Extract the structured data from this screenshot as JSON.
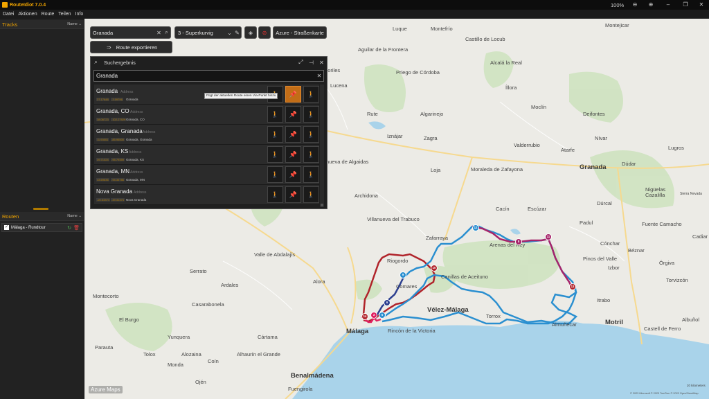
{
  "app": {
    "title": "RouteIdiot 7.0.4",
    "zoom": "100%"
  },
  "menu": [
    "Datei",
    "Aktionen",
    "Route",
    "Teilen",
    "Info"
  ],
  "tracks_panel": {
    "title": "Tracks",
    "sort": "Name ⌄"
  },
  "routes_panel": {
    "title": "Routen",
    "sort": "Name ⌄",
    "items": [
      {
        "name": "Málaga - Rundtour",
        "checked": true
      }
    ]
  },
  "toolbar": {
    "search_value": "Granada",
    "style_select": "3 - Superkurvig",
    "map_style": "Azure - Straßenkarte",
    "export_label": "Route exportieren"
  },
  "search_panel": {
    "title": "Suchergebnis",
    "query": "Granada",
    "tooltip": "Fügt der aktuellen Route einen Via-Punkt hinzu",
    "results": [
      {
        "name": "Granada",
        "type": "Address",
        "lat": "37.17648",
        "lon": "-3.59796",
        "sub": "Granada"
      },
      {
        "name": "Granada, CO",
        "type": "Address",
        "lat": "38.06723",
        "lon": "-102.27929",
        "sub": "Granada, CO"
      },
      {
        "name": "Granada, Granada",
        "type": "Address",
        "lat": "11.93001",
        "lon": "-85.95500",
        "sub": "Granada, Granada"
      },
      {
        "name": "Granada, KS",
        "type": "Address",
        "lat": "39.71024",
        "lon": "-95.79359",
        "sub": "Granada, KS"
      },
      {
        "name": "Granada, MN",
        "type": "Address",
        "lat": "43.69636",
        "lon": "-94.34786",
        "sub": "Granada, MN"
      },
      {
        "name": "Nova Granada",
        "type": "Address",
        "lat": "-20.53374",
        "lon": "-49.31374",
        "sub": "Nova Granada"
      }
    ]
  },
  "map": {
    "provider_logo": "Azure Maps",
    "copyright": "© 2023 Microsoft  © 2023 TomTom  © 2023 OpenStreetMap",
    "scale": "20 kilometers",
    "places": [
      {
        "name": "Luque",
        "big": false
      },
      {
        "name": "Montefrío",
        "big": false
      },
      {
        "name": "Castillo de Locub",
        "big": false
      },
      {
        "name": "Montejicar",
        "big": false
      },
      {
        "name": "Alcalá la Real",
        "big": false
      },
      {
        "name": "Priego de Córdoba",
        "big": false
      },
      {
        "name": "Lucena",
        "big": false
      },
      {
        "name": "Íllora",
        "big": false
      },
      {
        "name": "Moclín",
        "big": false
      },
      {
        "name": "Deifontes",
        "big": false
      },
      {
        "name": "Rute",
        "big": false
      },
      {
        "name": "Algarinejo",
        "big": false
      },
      {
        "name": "Iznájar",
        "big": false
      },
      {
        "name": "Zagra",
        "big": false
      },
      {
        "name": "Valderrubio",
        "big": false
      },
      {
        "name": "Atarfe",
        "big": false
      },
      {
        "name": "Nívar",
        "big": false
      },
      {
        "name": "Granada",
        "big": true
      },
      {
        "name": "Dúdar",
        "big": false
      },
      {
        "name": "Lugros",
        "big": false
      },
      {
        "name": "Villanueva de Algaidas",
        "big": false
      },
      {
        "name": "Loja",
        "big": false
      },
      {
        "name": "Moraleda de Zafayona",
        "big": false
      },
      {
        "name": "Archidona",
        "big": false
      },
      {
        "name": "Cacín",
        "big": false
      },
      {
        "name": "Escúzar",
        "big": false
      },
      {
        "name": "Padul",
        "big": false
      },
      {
        "name": "Villanueva del Trabuco",
        "big": false
      },
      {
        "name": "Zafarraya",
        "big": false
      },
      {
        "name": "Arenas del Rey",
        "big": false
      },
      {
        "name": "Valle de Abdalajís",
        "big": false
      },
      {
        "name": "Alora",
        "big": false
      },
      {
        "name": "Riogordo",
        "big": false
      },
      {
        "name": "Comares",
        "big": false
      },
      {
        "name": "Canillas de Aceituno",
        "big": false
      },
      {
        "name": "Vélez-Málaga",
        "big": true
      },
      {
        "name": "Torrox",
        "big": false
      },
      {
        "name": "Almuñécar",
        "big": false
      },
      {
        "name": "Motril",
        "big": true
      },
      {
        "name": "Málaga",
        "big": true
      },
      {
        "name": "Rincón de la Victoria",
        "big": false
      },
      {
        "name": "Benalmádena",
        "big": true
      },
      {
        "name": "Fuengirola",
        "big": false
      },
      {
        "name": "Coín",
        "big": false
      },
      {
        "name": "Cártama",
        "big": false
      },
      {
        "name": "Alhaurín el Grande",
        "big": false
      },
      {
        "name": "Monda",
        "big": false
      },
      {
        "name": "Ojén",
        "big": false
      },
      {
        "name": "Tolox",
        "big": false
      },
      {
        "name": "Casarabonela",
        "big": false
      },
      {
        "name": "Ardales",
        "big": false
      },
      {
        "name": "Serrato",
        "big": false
      },
      {
        "name": "Montecorto",
        "big": false
      },
      {
        "name": "El Burgo",
        "big": false
      },
      {
        "name": "Yunquera",
        "big": false
      },
      {
        "name": "Parauta",
        "big": false
      },
      {
        "name": "Alozaina",
        "big": false
      },
      {
        "name": "Castell de Ferro",
        "big": false
      },
      {
        "name": "Albuñol",
        "big": false
      },
      {
        "name": "Órgiva",
        "big": false
      },
      {
        "name": "Cadiar",
        "big": false
      },
      {
        "name": "Itrabo",
        "big": false
      },
      {
        "name": "Cónchar",
        "big": false
      },
      {
        "name": "Béznar",
        "big": false
      },
      {
        "name": "Torvizcón",
        "big": false
      },
      {
        "name": "Dúrcal",
        "big": false
      },
      {
        "name": "Pinos del Valle",
        "big": false
      },
      {
        "name": "Fuente Camacho",
        "big": false
      },
      {
        "name": "Aguilar de la Frontera",
        "big": false
      },
      {
        "name": "Moriles",
        "big": false
      },
      {
        "name": "Cazalilla",
        "big": false
      },
      {
        "name": "Sierra Nevada",
        "big": false
      },
      {
        "name": "Izbor",
        "big": false
      },
      {
        "name": "Nigüelas",
        "big": false
      }
    ]
  },
  "colors": {
    "accent": "#f0a400",
    "route_red": "#b0232a",
    "route_blue": "#2a8fd0",
    "route_purple": "#a6246a",
    "sea": "#a9d3ea"
  }
}
